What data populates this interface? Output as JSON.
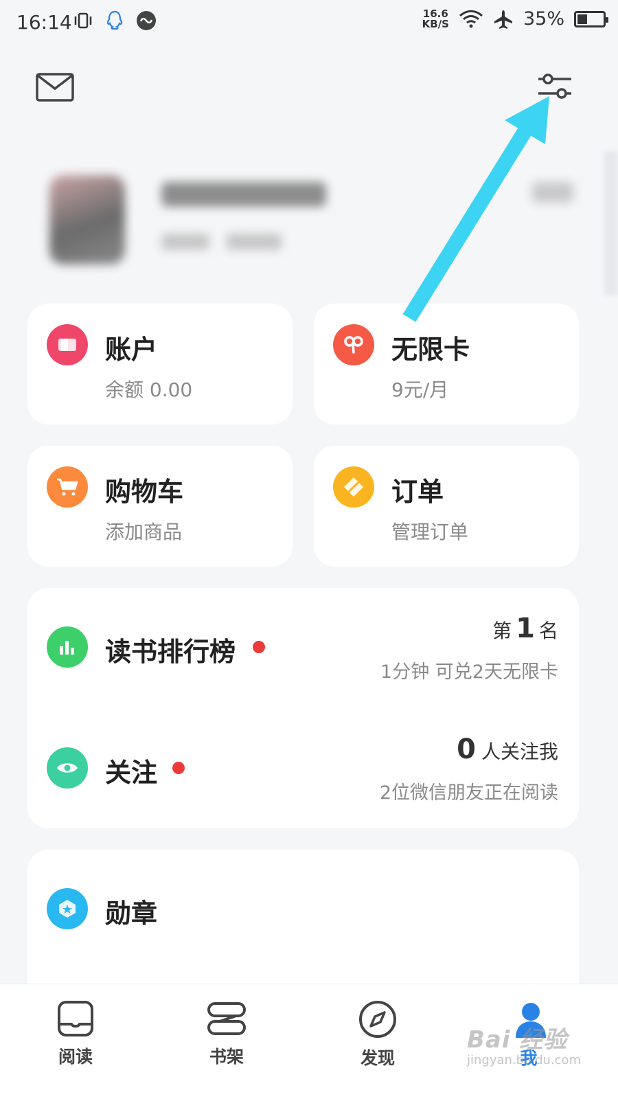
{
  "status_bar": {
    "time": "16:14",
    "net_speed_value": "16.6",
    "net_speed_unit": "KB/S",
    "battery": "35%",
    "battery_level": 0.35
  },
  "header": {
    "mail_icon": "mail-icon",
    "settings_icon": "settings-sliders-icon"
  },
  "cards": {
    "account": {
      "title": "账户",
      "subtitle": "余额 0.00",
      "icon_color": "#f0466a"
    },
    "unlimited": {
      "title": "无限卡",
      "subtitle": "9元/月",
      "icon_color": "#f45a46"
    },
    "cart": {
      "title": "购物车",
      "subtitle": "添加商品",
      "icon_color": "#fb8a3c"
    },
    "order": {
      "title": "订单",
      "subtitle": "管理订单",
      "icon_color": "#f9b41f"
    }
  },
  "ranking": {
    "title": "读书排行榜",
    "rank_prefix": "第",
    "rank_value": "1",
    "rank_suffix": "名",
    "subtitle": "1分钟 可兑2天无限卡",
    "icon_color": "#3ccf6a"
  },
  "follow": {
    "title": "关注",
    "count": "0",
    "count_suffix": "人关注我",
    "subtitle": "2位微信朋友正在阅读",
    "icon_color": "#3ccfa0"
  },
  "medal": {
    "title": "勋章",
    "icon_color": "#29b8f0"
  },
  "bottom_nav": {
    "items": [
      {
        "label": "阅读",
        "icon": "book-open-icon"
      },
      {
        "label": "书架",
        "icon": "bookshelf-icon"
      },
      {
        "label": "发现",
        "icon": "compass-icon"
      },
      {
        "label": "我",
        "icon": "person-icon",
        "active": true
      }
    ],
    "active_color": "#2a82e4"
  },
  "watermark": {
    "main": "Bai 经验",
    "sub": "jingyan.baidu.com"
  },
  "annotation": {
    "arrow_color": "#3dd4f3"
  }
}
